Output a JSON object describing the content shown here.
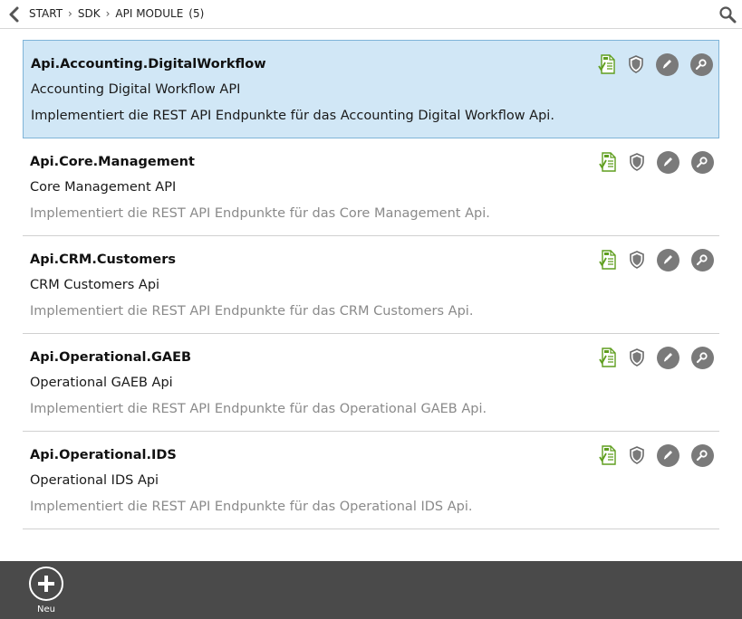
{
  "breadcrumb": {
    "items": [
      "START",
      "SDK",
      "API MODULE"
    ],
    "count": "(5)",
    "separator": "›"
  },
  "modules": [
    {
      "name": "Api.Accounting.DigitalWorkflow",
      "title": "Accounting Digital Workflow API",
      "description": "Implementiert die REST API Endpunkte für das Accounting Digital Workflow Api.",
      "selected": true
    },
    {
      "name": "Api.Core.Management",
      "title": "Core Management API",
      "description": "Implementiert die REST API Endpunkte für das Core Management Api.",
      "selected": false
    },
    {
      "name": "Api.CRM.Customers",
      "title": "CRM Customers Api",
      "description": "Implementiert die REST API Endpunkte für das CRM Customers Api.",
      "selected": false
    },
    {
      "name": "Api.Operational.GAEB",
      "title": "Operational GAEB Api",
      "description": "Implementiert die REST API Endpunkte für das Operational GAEB Api.",
      "selected": false
    },
    {
      "name": "Api.Operational.IDS",
      "title": "Operational IDS Api",
      "description": "Implementiert die REST API Endpunkte für das Operational IDS Api.",
      "selected": false
    }
  ],
  "actions": [
    "document-check-icon",
    "shield-icon",
    "edit-icon",
    "search-detail-icon"
  ],
  "bottom": {
    "new_label": "Neu"
  },
  "colors": {
    "selected_bg": "#d1e7f6",
    "selected_border": "#7fb4d8",
    "accent_green": "#5f9e1e",
    "bottom_bar": "#4a4a4a"
  }
}
